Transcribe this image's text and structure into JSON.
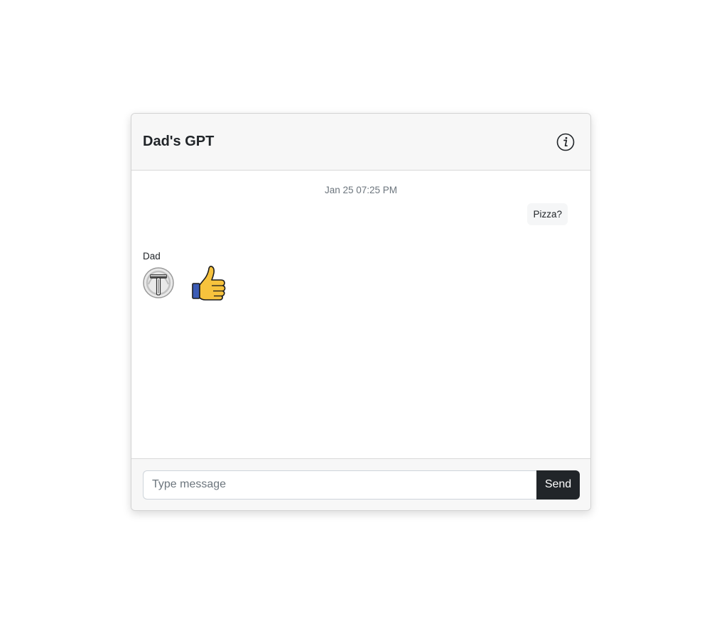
{
  "header": {
    "title": "Dad's GPT",
    "info_icon": "info-circle-icon"
  },
  "chat": {
    "timestamp": "Jan 25 07:25 PM",
    "messages": [
      {
        "direction": "outgoing",
        "text": "Pizza?"
      },
      {
        "direction": "incoming",
        "sender": "Dad",
        "avatar_icon": "hammer-avatar-icon",
        "content_icon": "thumbs-up-emoji"
      }
    ]
  },
  "composer": {
    "placeholder": "Type message",
    "value": "",
    "send_label": "Send"
  },
  "colors": {
    "header_bg": "#f7f7f7",
    "send_button": "#212529",
    "bubble_bg": "#f5f6f7",
    "thumb_yellow": "#f7c33d",
    "cuff_blue": "#3b5bb5"
  }
}
